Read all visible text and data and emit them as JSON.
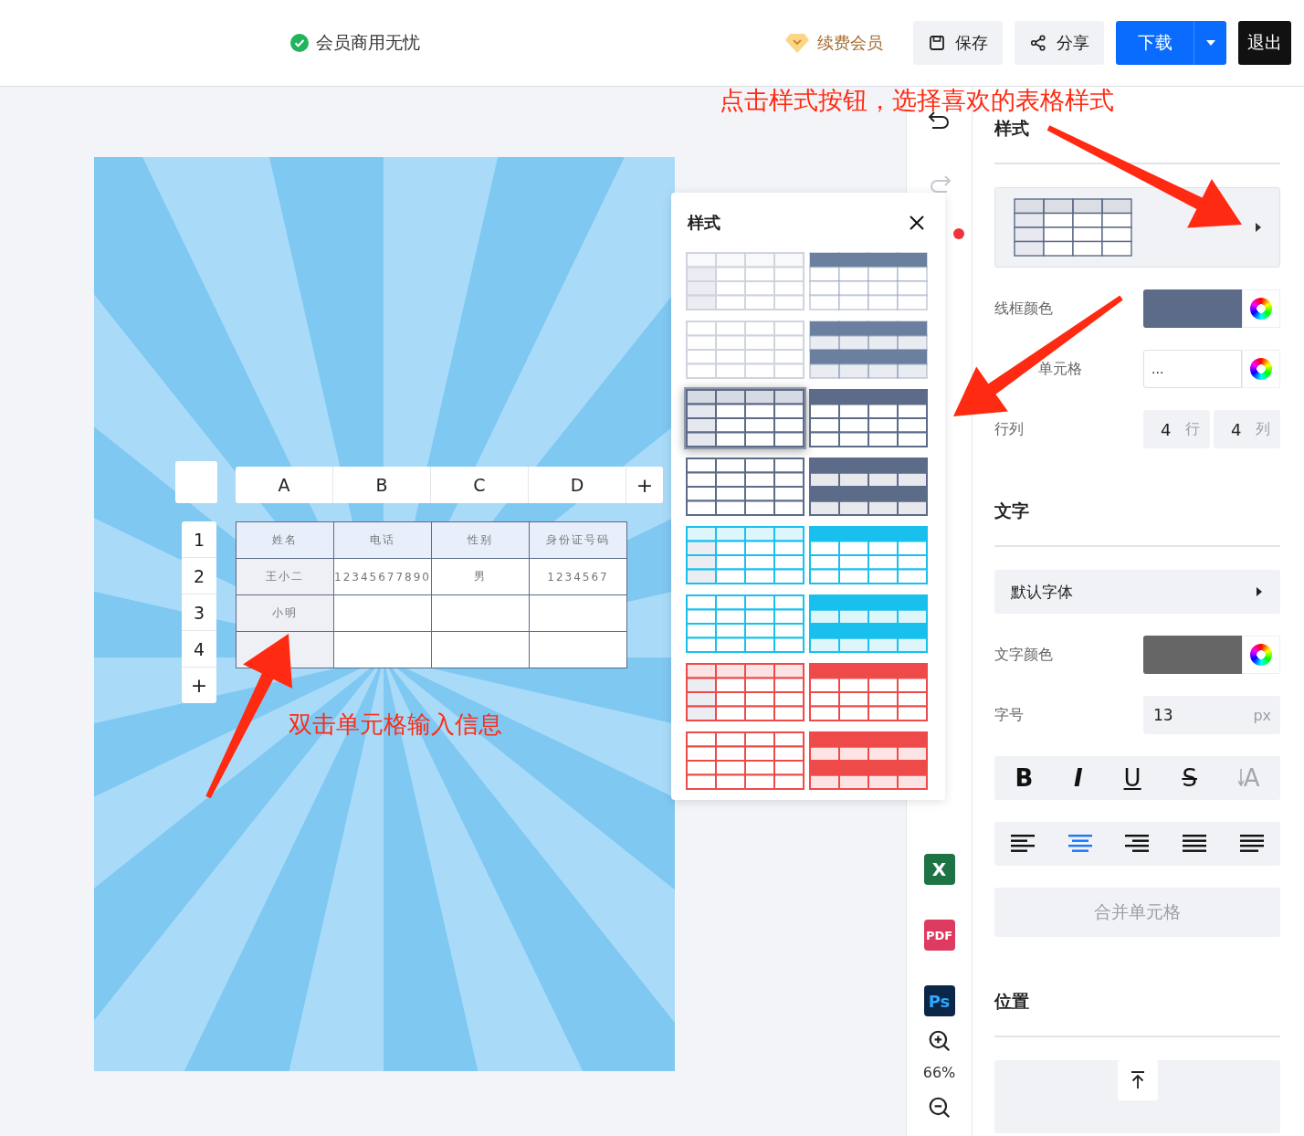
{
  "topbar": {
    "member_status": "会员商用无忧",
    "renew": "续费会员",
    "save": "保存",
    "share": "分享",
    "download": "下载",
    "exit": "退出"
  },
  "annotations": {
    "top": "点击样式按钮，选择喜欢的表格样式",
    "sheet": "双击单元格输入信息"
  },
  "sheet": {
    "columns": [
      "A",
      "B",
      "C",
      "D"
    ],
    "add_column": "+",
    "add_row": "+",
    "rows": [
      {
        "number": "1",
        "cells": [
          "姓名",
          "电话",
          "性别",
          "身份证号码"
        ]
      },
      {
        "number": "2",
        "cells": [
          "王小二",
          "12345677890",
          "男",
          "1234567"
        ]
      },
      {
        "number": "3",
        "cells": [
          "小明"
        ]
      },
      {
        "number": "4"
      }
    ]
  },
  "style_popup": {
    "title": "样式",
    "styles": [
      {
        "kind": "header-and-column",
        "color": "#cfd4dd",
        "faint": false,
        "selected": false
      },
      {
        "kind": "header",
        "color": "#6b7f9e",
        "faint": true,
        "selected": false
      },
      {
        "kind": "plain",
        "color": "#cfd4dd",
        "faint": false,
        "selected": false
      },
      {
        "kind": "banded",
        "color": "#6b7f9e",
        "faint": true,
        "selected": false
      },
      {
        "kind": "header-and-column",
        "color": "#5c6b87",
        "faint": false,
        "selected": true
      },
      {
        "kind": "header",
        "color": "#5c6b87",
        "faint": false,
        "selected": false
      },
      {
        "kind": "plain",
        "color": "#5c6b87",
        "faint": false,
        "selected": false
      },
      {
        "kind": "banded",
        "color": "#5c6b87",
        "faint": false,
        "selected": false
      },
      {
        "kind": "header-and-column",
        "color": "#19c0ee",
        "faint": false,
        "selected": false
      },
      {
        "kind": "header",
        "color": "#19c0ee",
        "faint": false,
        "selected": false
      },
      {
        "kind": "plain",
        "color": "#19c0ee",
        "faint": false,
        "selected": false
      },
      {
        "kind": "banded",
        "color": "#19c0ee",
        "faint": false,
        "selected": false
      },
      {
        "kind": "header-and-column",
        "color": "#ef4a4a",
        "faint": false,
        "selected": false
      },
      {
        "kind": "header",
        "color": "#ef4a4a",
        "faint": false,
        "selected": false
      },
      {
        "kind": "plain",
        "color": "#ef4a4a",
        "faint": false,
        "selected": false
      },
      {
        "kind": "banded",
        "color": "#ef4a4a",
        "faint": false,
        "selected": false
      }
    ]
  },
  "toolbar": {
    "exports": [
      {
        "kind": "excel",
        "label": "X"
      },
      {
        "kind": "pdf",
        "label": "PDF"
      },
      {
        "kind": "ps",
        "label": "Ps"
      }
    ],
    "zoom": "66%"
  },
  "panel": {
    "style_title": "样式",
    "border_color": {
      "label": "线框颜色",
      "color": "#5c6b87"
    },
    "fill": {
      "label": "单元格",
      "value": "..."
    },
    "rows_cols": {
      "label": "行列",
      "rows": "4",
      "rows_unit": "行",
      "cols": "4",
      "cols_unit": "列"
    },
    "text_title": "文字",
    "font": "默认字体",
    "text_color": {
      "label": "文字颜色",
      "color": "#666666"
    },
    "font_size": {
      "label": "字号",
      "value": "13",
      "unit": "px"
    },
    "formats": [
      {
        "kind": "bold",
        "label": "B",
        "disabled": false
      },
      {
        "kind": "italic",
        "label": "I",
        "disabled": false
      },
      {
        "kind": "underline",
        "label": "U",
        "disabled": false
      },
      {
        "kind": "strike",
        "label": "S",
        "disabled": false
      },
      {
        "kind": "vertical",
        "label": "A",
        "disabled": true
      }
    ],
    "aligns": [
      {
        "kind": "left",
        "selected": false
      },
      {
        "kind": "center",
        "selected": true
      },
      {
        "kind": "right",
        "selected": false
      },
      {
        "kind": "justify",
        "selected": false
      },
      {
        "kind": "distribute",
        "selected": false
      }
    ],
    "merge": {
      "label": "合并单元格",
      "disabled": true
    },
    "position_title": "位置"
  }
}
